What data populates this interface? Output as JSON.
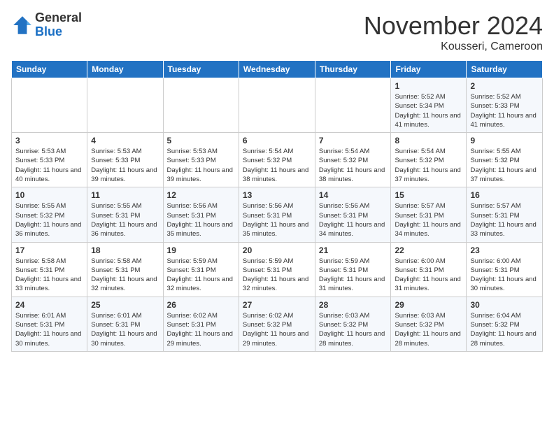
{
  "logo": {
    "general": "General",
    "blue": "Blue"
  },
  "header": {
    "month": "November 2024",
    "location": "Kousseri, Cameroon"
  },
  "weekdays": [
    "Sunday",
    "Monday",
    "Tuesday",
    "Wednesday",
    "Thursday",
    "Friday",
    "Saturday"
  ],
  "weeks": [
    [
      {
        "day": "",
        "info": ""
      },
      {
        "day": "",
        "info": ""
      },
      {
        "day": "",
        "info": ""
      },
      {
        "day": "",
        "info": ""
      },
      {
        "day": "",
        "info": ""
      },
      {
        "day": "1",
        "info": "Sunrise: 5:52 AM\nSunset: 5:34 PM\nDaylight: 11 hours and 41 minutes."
      },
      {
        "day": "2",
        "info": "Sunrise: 5:52 AM\nSunset: 5:33 PM\nDaylight: 11 hours and 41 minutes."
      }
    ],
    [
      {
        "day": "3",
        "info": "Sunrise: 5:53 AM\nSunset: 5:33 PM\nDaylight: 11 hours and 40 minutes."
      },
      {
        "day": "4",
        "info": "Sunrise: 5:53 AM\nSunset: 5:33 PM\nDaylight: 11 hours and 39 minutes."
      },
      {
        "day": "5",
        "info": "Sunrise: 5:53 AM\nSunset: 5:33 PM\nDaylight: 11 hours and 39 minutes."
      },
      {
        "day": "6",
        "info": "Sunrise: 5:54 AM\nSunset: 5:32 PM\nDaylight: 11 hours and 38 minutes."
      },
      {
        "day": "7",
        "info": "Sunrise: 5:54 AM\nSunset: 5:32 PM\nDaylight: 11 hours and 38 minutes."
      },
      {
        "day": "8",
        "info": "Sunrise: 5:54 AM\nSunset: 5:32 PM\nDaylight: 11 hours and 37 minutes."
      },
      {
        "day": "9",
        "info": "Sunrise: 5:55 AM\nSunset: 5:32 PM\nDaylight: 11 hours and 37 minutes."
      }
    ],
    [
      {
        "day": "10",
        "info": "Sunrise: 5:55 AM\nSunset: 5:32 PM\nDaylight: 11 hours and 36 minutes."
      },
      {
        "day": "11",
        "info": "Sunrise: 5:55 AM\nSunset: 5:31 PM\nDaylight: 11 hours and 36 minutes."
      },
      {
        "day": "12",
        "info": "Sunrise: 5:56 AM\nSunset: 5:31 PM\nDaylight: 11 hours and 35 minutes."
      },
      {
        "day": "13",
        "info": "Sunrise: 5:56 AM\nSunset: 5:31 PM\nDaylight: 11 hours and 35 minutes."
      },
      {
        "day": "14",
        "info": "Sunrise: 5:56 AM\nSunset: 5:31 PM\nDaylight: 11 hours and 34 minutes."
      },
      {
        "day": "15",
        "info": "Sunrise: 5:57 AM\nSunset: 5:31 PM\nDaylight: 11 hours and 34 minutes."
      },
      {
        "day": "16",
        "info": "Sunrise: 5:57 AM\nSunset: 5:31 PM\nDaylight: 11 hours and 33 minutes."
      }
    ],
    [
      {
        "day": "17",
        "info": "Sunrise: 5:58 AM\nSunset: 5:31 PM\nDaylight: 11 hours and 33 minutes."
      },
      {
        "day": "18",
        "info": "Sunrise: 5:58 AM\nSunset: 5:31 PM\nDaylight: 11 hours and 32 minutes."
      },
      {
        "day": "19",
        "info": "Sunrise: 5:59 AM\nSunset: 5:31 PM\nDaylight: 11 hours and 32 minutes."
      },
      {
        "day": "20",
        "info": "Sunrise: 5:59 AM\nSunset: 5:31 PM\nDaylight: 11 hours and 32 minutes."
      },
      {
        "day": "21",
        "info": "Sunrise: 5:59 AM\nSunset: 5:31 PM\nDaylight: 11 hours and 31 minutes."
      },
      {
        "day": "22",
        "info": "Sunrise: 6:00 AM\nSunset: 5:31 PM\nDaylight: 11 hours and 31 minutes."
      },
      {
        "day": "23",
        "info": "Sunrise: 6:00 AM\nSunset: 5:31 PM\nDaylight: 11 hours and 30 minutes."
      }
    ],
    [
      {
        "day": "24",
        "info": "Sunrise: 6:01 AM\nSunset: 5:31 PM\nDaylight: 11 hours and 30 minutes."
      },
      {
        "day": "25",
        "info": "Sunrise: 6:01 AM\nSunset: 5:31 PM\nDaylight: 11 hours and 30 minutes."
      },
      {
        "day": "26",
        "info": "Sunrise: 6:02 AM\nSunset: 5:31 PM\nDaylight: 11 hours and 29 minutes."
      },
      {
        "day": "27",
        "info": "Sunrise: 6:02 AM\nSunset: 5:32 PM\nDaylight: 11 hours and 29 minutes."
      },
      {
        "day": "28",
        "info": "Sunrise: 6:03 AM\nSunset: 5:32 PM\nDaylight: 11 hours and 28 minutes."
      },
      {
        "day": "29",
        "info": "Sunrise: 6:03 AM\nSunset: 5:32 PM\nDaylight: 11 hours and 28 minutes."
      },
      {
        "day": "30",
        "info": "Sunrise: 6:04 AM\nSunset: 5:32 PM\nDaylight: 11 hours and 28 minutes."
      }
    ]
  ]
}
